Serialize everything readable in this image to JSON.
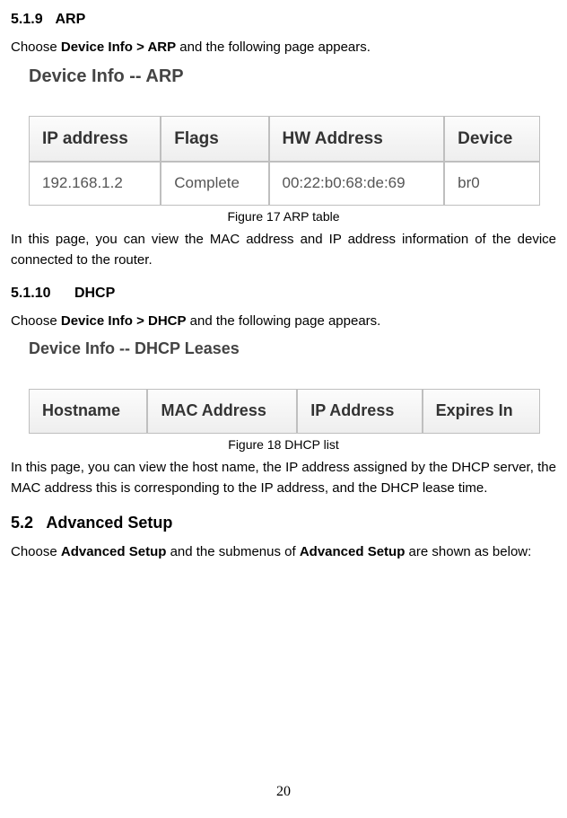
{
  "sections": {
    "arp": {
      "num": "5.1.9",
      "title": "ARP",
      "choose_pre": "Choose ",
      "choose_bold": "Device Info > ARP",
      "choose_post": " and the following page appears.",
      "emb_title": "Device Info -- ARP",
      "headers": [
        "IP address",
        "Flags",
        "HW Address",
        "Device"
      ],
      "row": [
        "192.168.1.2",
        "Complete",
        "00:22:b0:68:de:69",
        "br0"
      ],
      "caption": "Figure 17 ARP table",
      "desc": "In this page, you can view the MAC address and IP address information of the device connected to the router."
    },
    "dhcp": {
      "num": "5.1.10",
      "title": "DHCP",
      "choose_pre": "Choose ",
      "choose_bold": "Device Info > DHCP",
      "choose_post": " and the following page appears.",
      "emb_title": "Device Info -- DHCP Leases",
      "headers": [
        "Hostname",
        "MAC Address",
        "IP Address",
        "Expires In"
      ],
      "caption": "Figure 18 DHCP list",
      "desc": "In this page, you can view the host name, the IP address assigned by the DHCP server, the MAC address this is corresponding to the IP address, and the DHCP lease time."
    },
    "advanced": {
      "num": "5.2",
      "title": "Advanced Setup",
      "choose_pre": "Choose ",
      "choose_bold1": "Advanced Setup",
      "choose_mid": " and the submenus of ",
      "choose_bold2": "Advanced Setup",
      "choose_post": " are shown as below:"
    }
  },
  "page_number": "20"
}
